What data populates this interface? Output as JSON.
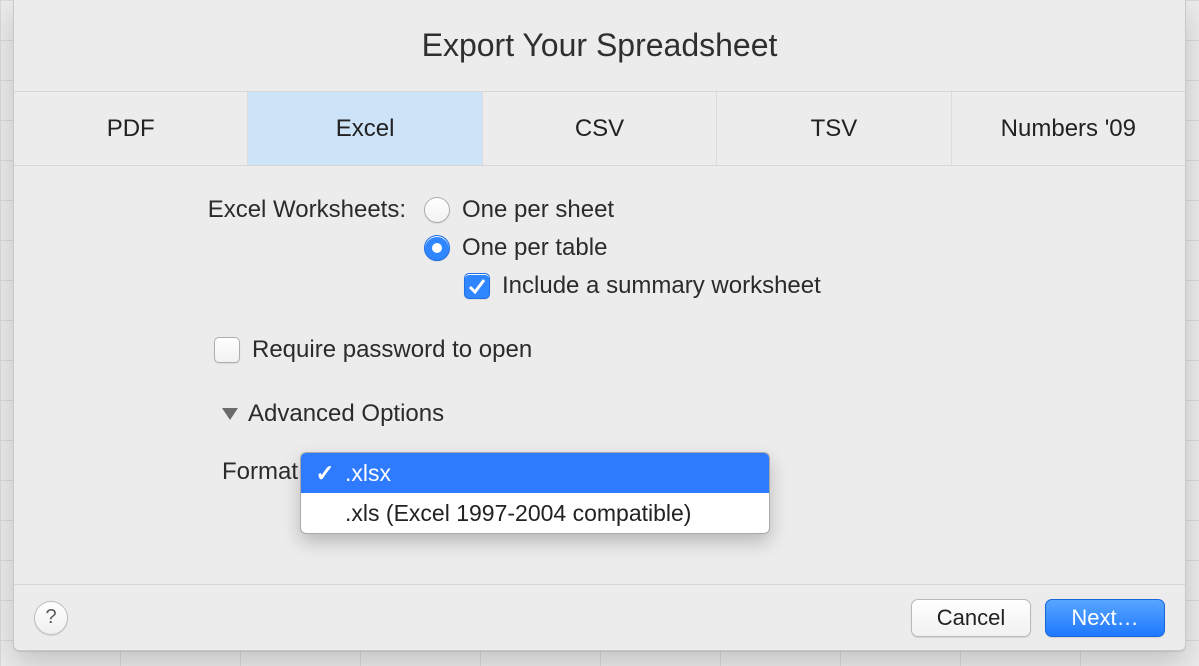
{
  "title": "Export Your Spreadsheet",
  "tabs": [
    {
      "label": "PDF",
      "selected": false
    },
    {
      "label": "Excel",
      "selected": true
    },
    {
      "label": "CSV",
      "selected": false
    },
    {
      "label": "TSV",
      "selected": false
    },
    {
      "label": "Numbers '09",
      "selected": false
    }
  ],
  "worksheets": {
    "label": "Excel Worksheets:",
    "options": [
      {
        "label": "One per sheet",
        "selected": false
      },
      {
        "label": "One per table",
        "selected": true
      }
    ],
    "summary": {
      "label": "Include a summary worksheet",
      "checked": true
    }
  },
  "require_password": {
    "label": "Require password to open",
    "checked": false
  },
  "advanced_label": "Advanced Options",
  "format": {
    "label": "Format",
    "options": [
      {
        "label": ".xlsx",
        "selected": true
      },
      {
        "label": ".xls (Excel 1997-2004 compatible)",
        "selected": false
      }
    ]
  },
  "footer": {
    "help": "?",
    "cancel": "Cancel",
    "next": "Next…"
  }
}
